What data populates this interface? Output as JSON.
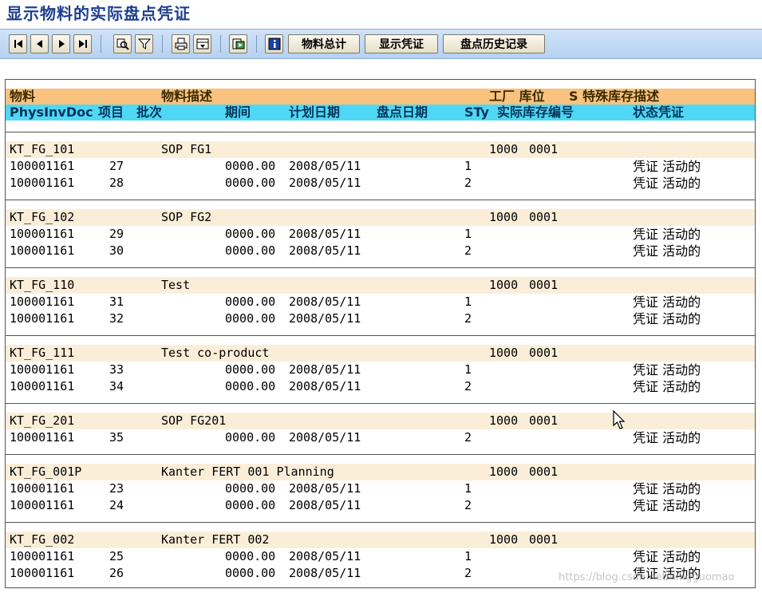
{
  "title": "显示物料的实际盘点凭证",
  "toolbar": {
    "icons": [
      "first-page-icon",
      "previous-page-icon",
      "next-page-icon",
      "last-page-icon",
      "find-icon",
      "filter-icon",
      "print-icon",
      "layout-icon",
      "export-icon",
      "info-icon"
    ],
    "buttons": [
      "物料总计",
      "显示凭证",
      "盘点历史记录"
    ]
  },
  "header1": {
    "material": "物料",
    "description": "物料描述",
    "plant_sloc": "工厂  库位",
    "special": "S 特殊库存描述"
  },
  "header2": {
    "doc": "PhysInvDoc",
    "item": "项目",
    "batch": "批次",
    "period": "期间",
    "plan_date": "计划日期",
    "count_date": "盘点日期",
    "sty": "STy",
    "stock_num": "实际库存编号",
    "status": "状态凭证"
  },
  "groups": [
    {
      "material": "KT_FG_101",
      "description": "SOP FG1",
      "plant": "1000",
      "sloc": "0001",
      "rows": [
        {
          "doc": "100001161",
          "item": "27",
          "period": "0000.00",
          "date": "2008/05/11",
          "sty": "1",
          "status": "凭证 活动的"
        },
        {
          "doc": "100001161",
          "item": "28",
          "period": "0000.00",
          "date": "2008/05/11",
          "sty": "2",
          "status": "凭证 活动的"
        }
      ]
    },
    {
      "material": "KT_FG_102",
      "description": "SOP FG2",
      "plant": "1000",
      "sloc": "0001",
      "rows": [
        {
          "doc": "100001161",
          "item": "29",
          "period": "0000.00",
          "date": "2008/05/11",
          "sty": "1",
          "status": "凭证 活动的"
        },
        {
          "doc": "100001161",
          "item": "30",
          "period": "0000.00",
          "date": "2008/05/11",
          "sty": "2",
          "status": "凭证 活动的"
        }
      ]
    },
    {
      "material": "KT_FG_110",
      "description": "Test",
      "plant": "1000",
      "sloc": "0001",
      "rows": [
        {
          "doc": "100001161",
          "item": "31",
          "period": "0000.00",
          "date": "2008/05/11",
          "sty": "1",
          "status": "凭证 活动的"
        },
        {
          "doc": "100001161",
          "item": "32",
          "period": "0000.00",
          "date": "2008/05/11",
          "sty": "2",
          "status": "凭证 活动的"
        }
      ]
    },
    {
      "material": "KT_FG_111",
      "description": "Test co-product",
      "plant": "1000",
      "sloc": "0001",
      "rows": [
        {
          "doc": "100001161",
          "item": "33",
          "period": "0000.00",
          "date": "2008/05/11",
          "sty": "1",
          "status": "凭证 活动的"
        },
        {
          "doc": "100001161",
          "item": "34",
          "period": "0000.00",
          "date": "2008/05/11",
          "sty": "2",
          "status": "凭证 活动的"
        }
      ]
    },
    {
      "material": "KT_FG_201",
      "description": "SOP FG201",
      "plant": "1000",
      "sloc": "0001",
      "rows": [
        {
          "doc": "100001161",
          "item": "35",
          "period": "0000.00",
          "date": "2008/05/11",
          "sty": "2",
          "status": "凭证 活动的"
        }
      ]
    },
    {
      "material": "KT_FG_001P",
      "description": "Kanter FERT 001 Planning",
      "plant": "1000",
      "sloc": "0001",
      "rows": [
        {
          "doc": "100001161",
          "item": "23",
          "period": "0000.00",
          "date": "2008/05/11",
          "sty": "1",
          "status": "凭证 活动的"
        },
        {
          "doc": "100001161",
          "item": "24",
          "period": "0000.00",
          "date": "2008/05/11",
          "sty": "2",
          "status": "凭证 活动的"
        }
      ]
    },
    {
      "material": "KT_FG_002",
      "description": "Kanter FERT 002",
      "plant": "1000",
      "sloc": "0001",
      "rows": [
        {
          "doc": "100001161",
          "item": "25",
          "period": "0000.00",
          "date": "2008/05/11",
          "sty": "1",
          "status": "凭证 活动的"
        },
        {
          "doc": "100001161",
          "item": "26",
          "period": "0000.00",
          "date": "2008/05/11",
          "sty": "2",
          "status": "凭证 活动的"
        }
      ]
    }
  ],
  "watermark": "https://blog.csdn.net/ningguomao"
}
